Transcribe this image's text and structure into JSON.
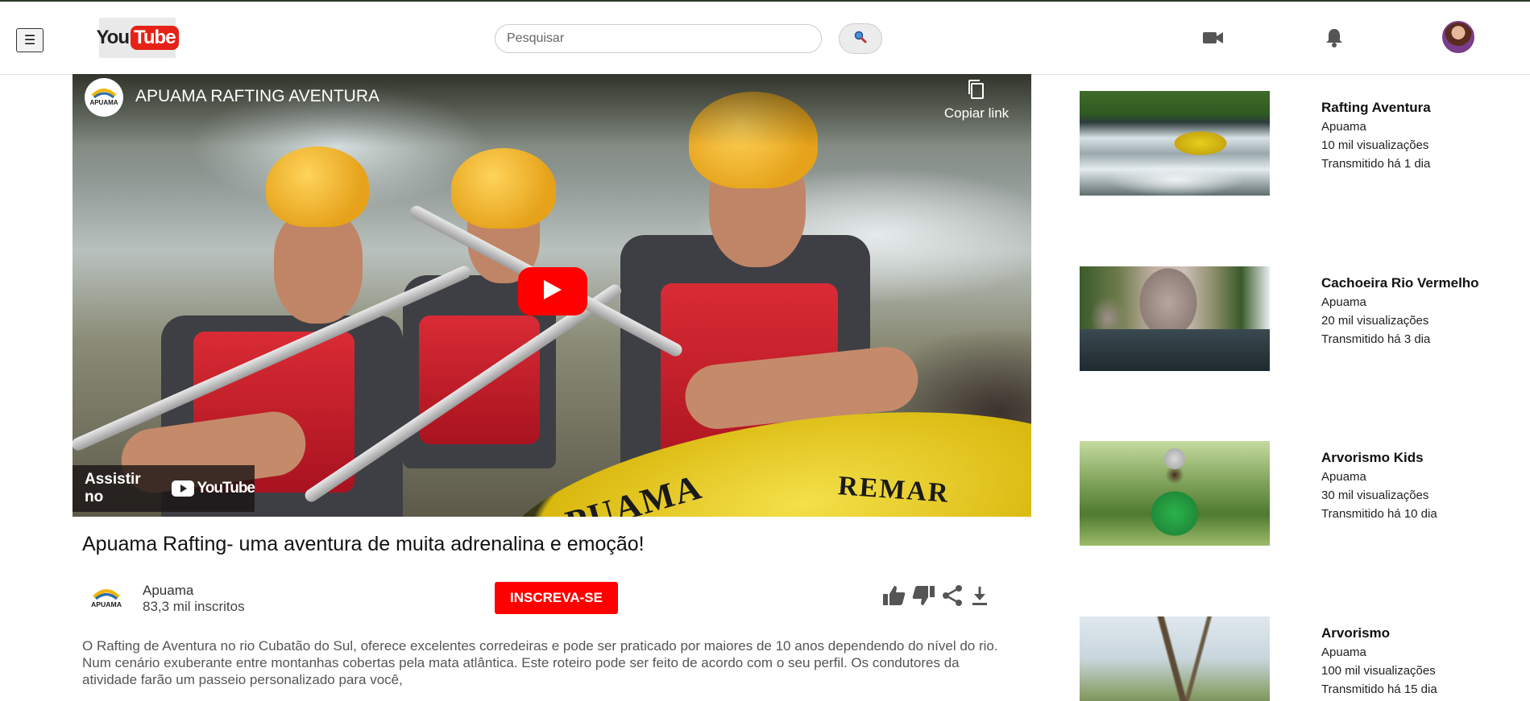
{
  "header": {
    "menu_glyph": "☰",
    "logo": {
      "you": "You",
      "tube": "Tube"
    },
    "search_placeholder": "Pesquisar"
  },
  "player": {
    "channel_title": "APUAMA RAFTING AVENTURA",
    "copy_link_label": "Copiar link",
    "watch_on_label": "Assistir no",
    "watch_on_brand": "YouTube",
    "raft_text_1": "PUAMA",
    "raft_text_2": "REMAR",
    "channel_logo_text": "APUAMA"
  },
  "video": {
    "title": "Apuama Rafting- uma aventura de muita adrenalina e emoção!",
    "channel_name": "Apuama",
    "subscribers": "83,3 mil inscritos",
    "subscribe_label": "INSCREVA-SE",
    "description": "O Rafting de Aventura no rio Cubatão do Sul, oferece excelentes corredeiras e pode ser praticado por maiores de 10 anos dependendo do nível do rio. Num cenário exuberante entre montanhas cobertas pela mata atlântica. Este roteiro pode ser feito de acordo com o seu perfil. Os condutores da atividade farão um passeio personalizado para você,"
  },
  "related": [
    {
      "title": "Rafting Aventura",
      "channel": "Apuama",
      "views": "10 mil visualizações",
      "age": "Transmitido há 1 dia"
    },
    {
      "title": "Cachoeira Rio Vermelho",
      "channel": "Apuama",
      "views": "20 mil visualizações",
      "age": "Transmitido há 3 dia"
    },
    {
      "title": "Arvorismo Kids",
      "channel": "Apuama",
      "views": "30 mil visualizações",
      "age": "Transmitido há 10 dia"
    },
    {
      "title": "Arvorismo",
      "channel": "Apuama",
      "views": "100 mil visualizações",
      "age": "Transmitido há 15 dia"
    }
  ],
  "colors": {
    "brand_red": "#ff0000",
    "youtube_red": "#e62117",
    "icon_gray": "#606060"
  }
}
